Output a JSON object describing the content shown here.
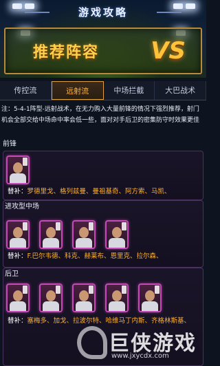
{
  "header": {
    "title": "游戏攻略",
    "banner_text": "推荐阵容",
    "vs_text": "VS"
  },
  "tabs": [
    {
      "label": "传控流",
      "active": false
    },
    {
      "label": "远射流",
      "active": true
    },
    {
      "label": "中场拦截",
      "active": false
    },
    {
      "label": "大巴战术",
      "active": false
    }
  ],
  "note": {
    "line1": "注：5-4-1阵型-远射战术，在无力购入大量前锋的情况下强烈推荐，射门",
    "line2": "机会全部交给中场命中率会低一些，面对对手后卫的密集防守时效果更佳"
  },
  "sections": {
    "forward": {
      "title": "前锋",
      "sub_label": "替补：",
      "sub_names": "罗德里戈、格列兹曼、曼祖基奇、阿方索、马凯、"
    },
    "attacking_mid": {
      "title": "进攻型中场",
      "sub_label": "替补：",
      "sub_names": "F.巴尔韦德、科克、赫莱布、恩里克、拉尔森、"
    },
    "defender": {
      "title": "后卫",
      "sub_label": "替补：",
      "sub_names": "塞梅多、加戈、拉波尔特、哈维马丁内斯、齐格林斯基、"
    }
  },
  "watermark": {
    "text": "巨侠游戏",
    "url": "www.jxycdx.com"
  },
  "colors": {
    "accent": "#ffb030",
    "card_border": "#c64ab8",
    "tab_active": "#ffb648"
  }
}
